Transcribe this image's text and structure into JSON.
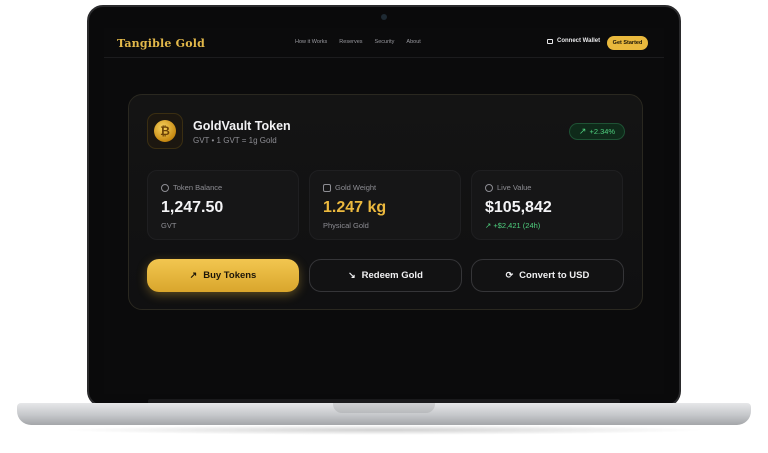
{
  "nav": {
    "brand": "Tangible Gold",
    "links": [
      "How it Works",
      "Reserves",
      "Security",
      "About"
    ],
    "connect_wallet": "Connect Wallet",
    "get_started": "Get Started"
  },
  "token": {
    "name": "GoldVault Token",
    "subtitle": "GVT • 1 GVT = 1g Gold",
    "change": "+2.34%",
    "logo_symbol": "₿"
  },
  "stats": [
    {
      "label": "Token Balance",
      "value": "1,247.50",
      "sub": "GVT",
      "icon": "coins-icon"
    },
    {
      "label": "Gold Weight",
      "value": "1.247 kg",
      "sub": "Physical Gold",
      "icon": "wallet-icon"
    },
    {
      "label": "Live Value",
      "value": "$105,842",
      "sub": "+$2,421 (24h)",
      "icon": "clock-icon"
    }
  ],
  "actions": {
    "buy": "Buy Tokens",
    "redeem": "Redeem Gold",
    "convert": "Convert to USD"
  },
  "colors": {
    "accent_gold": "#e9b93d",
    "positive_green": "#4fd07f",
    "background": "#0b0b0c"
  }
}
